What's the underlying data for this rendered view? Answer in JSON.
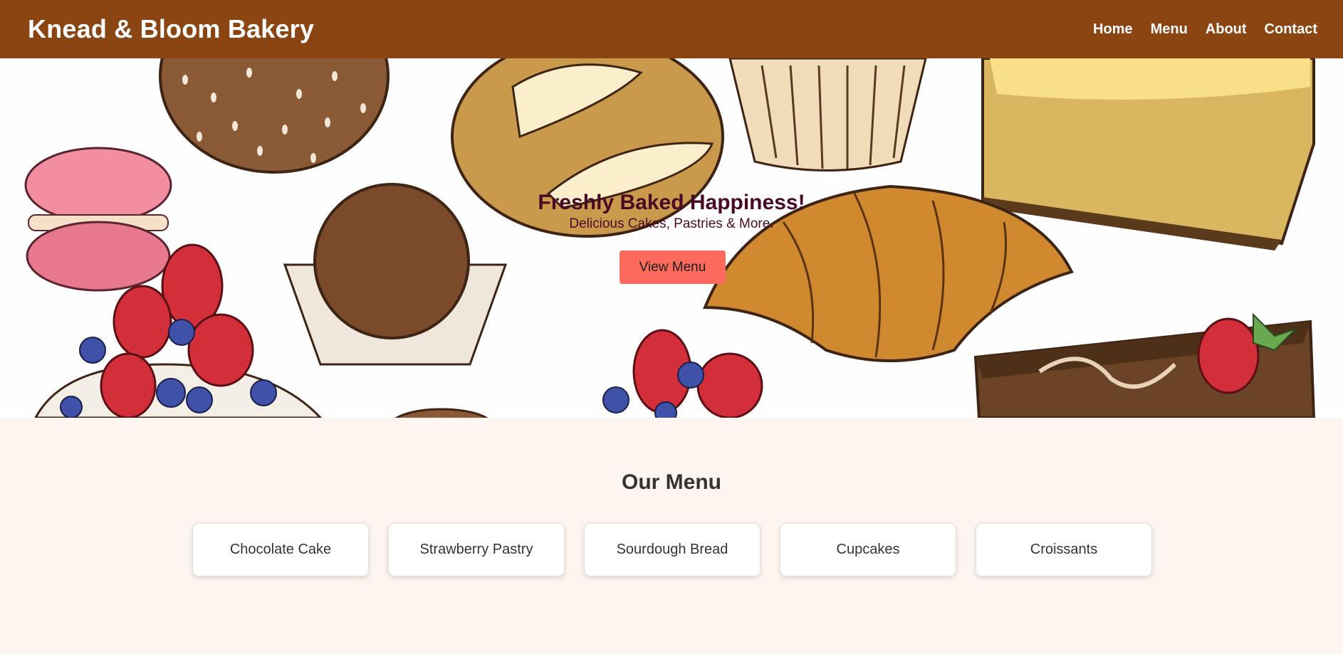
{
  "header": {
    "brand": "Knead & Bloom Bakery",
    "nav": [
      "Home",
      "Menu",
      "About",
      "Contact"
    ]
  },
  "hero": {
    "title": "Freshly Baked Happiness!",
    "subtitle": "Delicious Cakes, Pastries & More.",
    "button_label": "View Menu",
    "background": "hand-drawn bakery illustration pattern",
    "button_color": "#fb6a5d"
  },
  "menu": {
    "title": "Our Menu",
    "items": [
      "Chocolate Cake",
      "Strawberry Pastry",
      "Sourdough Bread",
      "Cupcakes",
      "Croissants"
    ]
  },
  "colors": {
    "header_bg": "#8b4513",
    "page_bg": "#fdf5ef",
    "hero_text": "#4a0a26"
  }
}
